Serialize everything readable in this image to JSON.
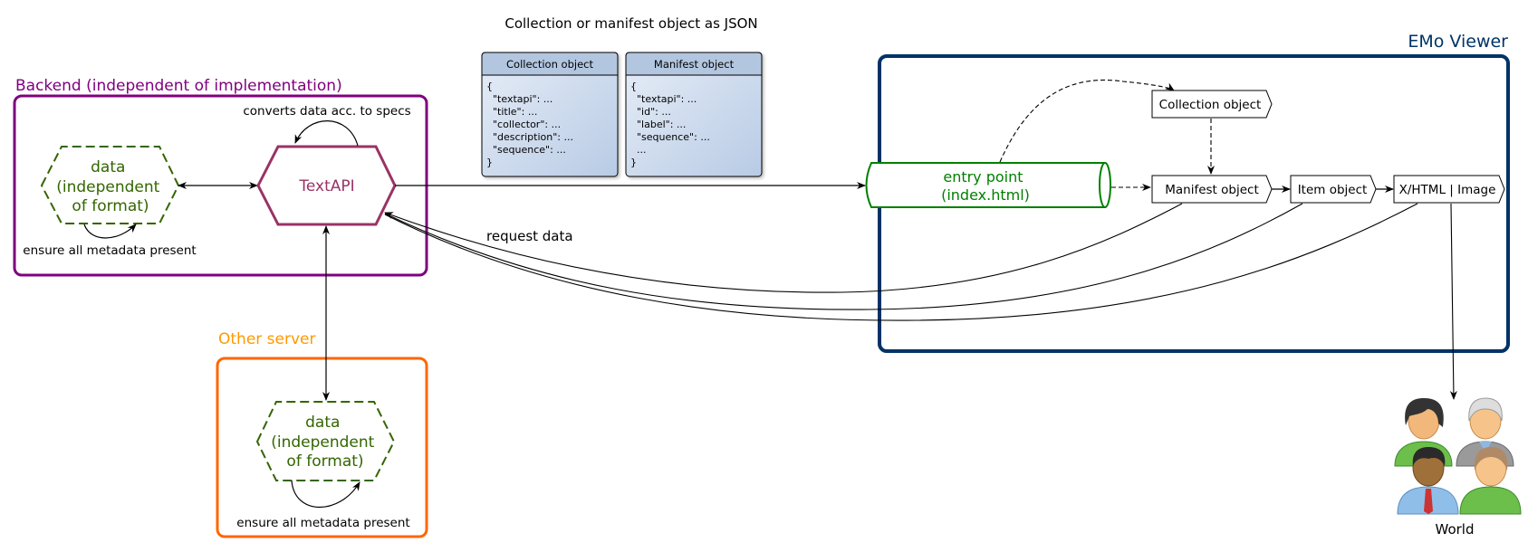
{
  "title": "Collection or manifest object as JSON",
  "backend": {
    "label": "Backend (independent of implementation)",
    "data_node": {
      "lines": [
        "data",
        "(independent",
        "of format)"
      ]
    },
    "data_loop_label": "ensure all metadata present",
    "textapi_label": "TextAPI",
    "textapi_loop_label": "converts data acc. to specs"
  },
  "other_server": {
    "label": "Other server",
    "data_node": {
      "lines": [
        "data",
        "(independent",
        "of format)"
      ]
    },
    "data_loop_label": "ensure all metadata present"
  },
  "json_cards": [
    {
      "header": "Collection object",
      "lines": [
        "{",
        "  \"textapi\": ...",
        "  \"title\": ...",
        "  \"collector\": ...",
        "  \"description\": ...",
        "  \"sequence\": ...",
        "}"
      ]
    },
    {
      "header": "Manifest object",
      "lines": [
        "{",
        "  \"textapi\": ...",
        "  \"id\": ...",
        "  \"label\": ...",
        "  \"sequence\": ...",
        "  ...",
        "}"
      ]
    }
  ],
  "viewer": {
    "label": "EMo Viewer",
    "entry_point": {
      "lines": [
        "entry point",
        "(index.html)"
      ]
    },
    "nodes": {
      "collection": "Collection object",
      "manifest": "Manifest object",
      "item": "Item object",
      "output": "X/HTML | Image"
    }
  },
  "edges": {
    "request_label": "request data"
  },
  "world": {
    "label": "World"
  },
  "colors": {
    "backend": "#800080",
    "textapi": "#993366",
    "data_green": "#336600",
    "entry_green": "#008000",
    "other_server": "#ff6600",
    "other_server_label": "#ff9900",
    "viewer": "#003366",
    "card_header": "#b3c6e0",
    "card_body": "#d4e1f2"
  }
}
